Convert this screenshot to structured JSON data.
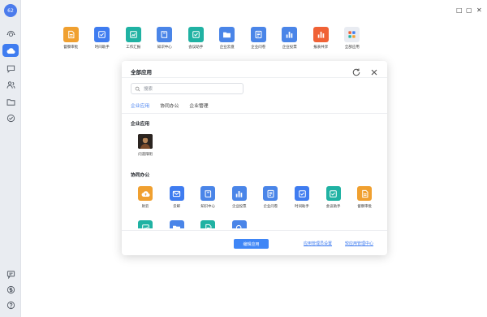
{
  "user": {
    "avatar_text": "62"
  },
  "window": {
    "minimize": "□",
    "maximize": "▢",
    "close": "✕"
  },
  "sidebar": {
    "top_items": [
      {
        "name": "contacts",
        "icon": "radar-icon",
        "active": false
      },
      {
        "name": "cloud",
        "icon": "cloud-icon",
        "active": true
      },
      {
        "name": "chat",
        "icon": "chat-icon",
        "active": false
      },
      {
        "name": "people",
        "icon": "people-icon",
        "active": false
      },
      {
        "name": "folder",
        "icon": "folder-icon",
        "active": false
      },
      {
        "name": "tasks",
        "icon": "check-circle-icon",
        "active": false
      }
    ],
    "bottom_items": [
      {
        "name": "messages",
        "icon": "message-icon"
      },
      {
        "name": "dollar",
        "icon": "dollar-icon"
      },
      {
        "name": "help",
        "icon": "help-icon"
      }
    ]
  },
  "top_apps": [
    {
      "label": "督察审批",
      "color": "#f0a030",
      "icon": "document-icon"
    },
    {
      "label": "时间助手",
      "color": "#3f7cf0",
      "icon": "check-square-icon"
    },
    {
      "label": "工作汇报",
      "color": "#20b2a3",
      "icon": "chart-icon"
    },
    {
      "label": "知识中心",
      "color": "#4a85e8",
      "icon": "book-icon"
    },
    {
      "label": "会议助手",
      "color": "#20b2a3",
      "icon": "check-square-icon"
    },
    {
      "label": "企业云盘",
      "color": "#4a85e8",
      "icon": "folder-icon"
    },
    {
      "label": "企业问卷",
      "color": "#4a85e8",
      "icon": "form-icon"
    },
    {
      "label": "企业投票",
      "color": "#4a85e8",
      "icon": "bar-chart-icon"
    },
    {
      "label": "报表共享",
      "color": "#f06236",
      "icon": "bar-chart-icon"
    },
    {
      "label": "全部应用",
      "color": "#e9ecf2",
      "icon": "grid-icon"
    }
  ],
  "modal": {
    "title": "全部应用",
    "search_placeholder": "搜索",
    "tabs": [
      "企业应用",
      "协同办公",
      "企业管理"
    ],
    "section_enterprise": "企业应用",
    "enterprise_apps": [
      {
        "label": "问道阳明",
        "icon": "portrait-icon"
      }
    ],
    "section_collab": "协同办公",
    "collab_apps": [
      {
        "label": "財云",
        "color": "#f0a030",
        "icon": "cloud-upload-icon"
      },
      {
        "label": "云邮",
        "color": "#3f7cf0",
        "icon": "mail-icon"
      },
      {
        "label": "知识中心",
        "color": "#4a85e8",
        "icon": "book-icon"
      },
      {
        "label": "企业投票",
        "color": "#4a85e8",
        "icon": "bar-chart-icon"
      },
      {
        "label": "企业问卷",
        "color": "#4a85e8",
        "icon": "form-icon"
      },
      {
        "label": "时间助手",
        "color": "#3f7cf0",
        "icon": "check-square-icon"
      },
      {
        "label": "会议助手",
        "color": "#20b2a3",
        "icon": "check-square-icon"
      },
      {
        "label": "督察审批",
        "color": "#f0a030",
        "icon": "document-icon"
      }
    ],
    "partial_row": [
      {
        "color": "#20b2a3",
        "icon": "chart-icon"
      },
      {
        "color": "#4a85e8",
        "icon": "folder-icon"
      },
      {
        "color": "#20b2a3",
        "icon": "document-icon"
      },
      {
        "color": "#4a85e8",
        "icon": "search-icon"
      }
    ],
    "edit_button": "编辑应用",
    "link_admin_settings": "应用管理员设置",
    "link_admin_center": "较应用管理中心"
  }
}
